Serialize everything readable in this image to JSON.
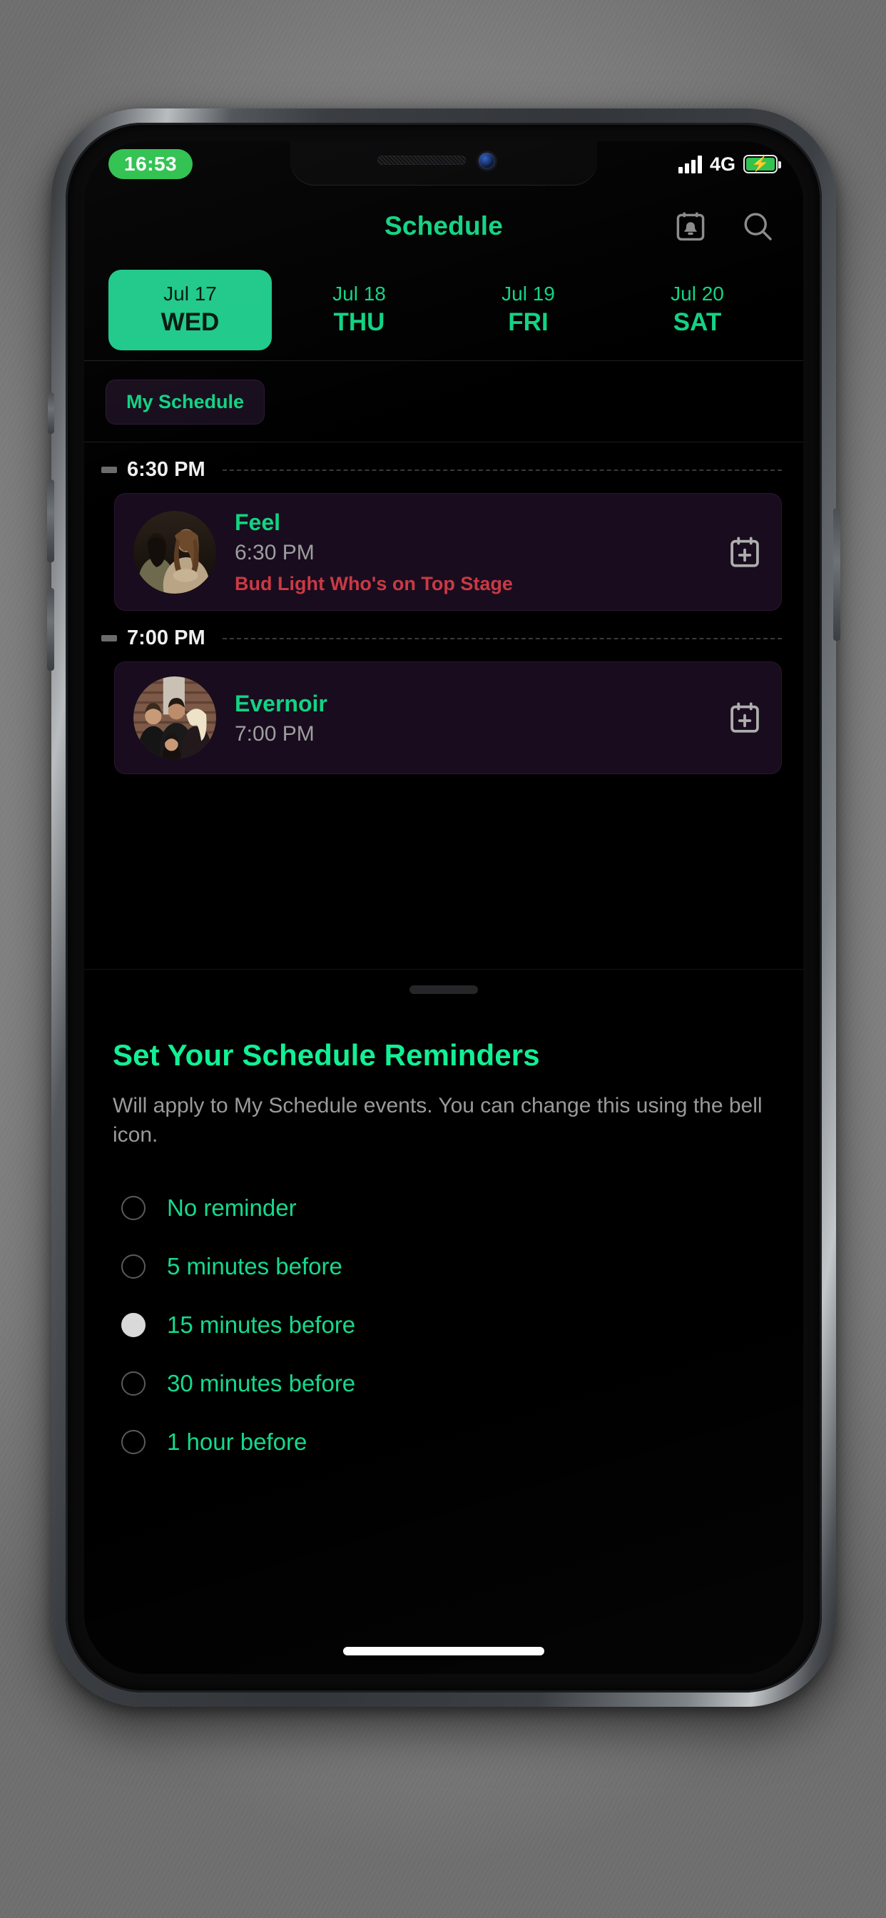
{
  "status_bar": {
    "time": "16:53",
    "network": "4G",
    "signal_icon": "signal-bars-icon",
    "battery_icon": "battery-charging-icon",
    "battery_color": "#2ec14e",
    "time_pill_color": "#2ec14e"
  },
  "header": {
    "title": "Schedule",
    "reminder_icon": "calendar-bell-icon",
    "search_icon": "search-icon"
  },
  "dates": {
    "tabs": [
      {
        "date": "Jul 17",
        "day": "WED",
        "selected": true
      },
      {
        "date": "Jul 18",
        "day": "THU",
        "selected": false
      },
      {
        "date": "Jul 19",
        "day": "FRI",
        "selected": false
      },
      {
        "date": "Jul 20",
        "day": "SAT",
        "selected": false
      }
    ],
    "active_color": "#1fc98a"
  },
  "filters": {
    "my_schedule_label": "My Schedule"
  },
  "timeline": {
    "groups": [
      {
        "time_label": "6:30 PM",
        "event": {
          "name": "Feel",
          "time": "6:30 PM",
          "stage": "Bud Light Who's on Top Stage",
          "stage_color": "#c93a44",
          "add_icon": "calendar-add-icon",
          "avatar_icon": "artist-photo"
        }
      },
      {
        "time_label": "7:00 PM",
        "event": {
          "name": "Evernoir",
          "time": "7:00 PM",
          "stage": "",
          "stage_color": "#c93a44",
          "add_icon": "calendar-add-icon",
          "avatar_icon": "artist-photo"
        }
      }
    ]
  },
  "sheet": {
    "grabber_icon": "drag-handle-icon",
    "title": "Set Your Schedule Reminders",
    "description": "Will apply to My Schedule events. You can change this using the bell icon.",
    "options": [
      {
        "label": "No reminder",
        "selected": false
      },
      {
        "label": "5 minutes before",
        "selected": false
      },
      {
        "label": "15 minutes before",
        "selected": true
      },
      {
        "label": "30 minutes before",
        "selected": false
      },
      {
        "label": "1 hour before",
        "selected": false
      }
    ],
    "accent_color": "#12f094"
  },
  "system": {
    "home_indicator_icon": "home-indicator"
  }
}
